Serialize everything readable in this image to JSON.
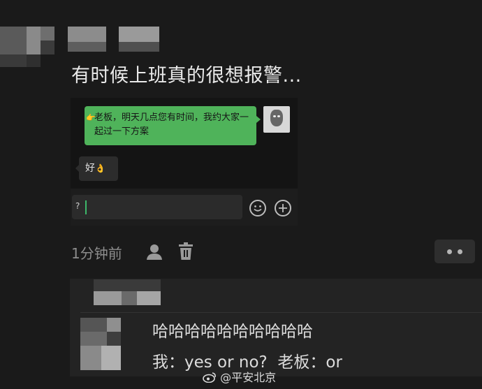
{
  "post": {
    "text": "有时候上班真的很想报警..."
  },
  "screenshot": {
    "boss_message": "老板，明天几点您有时间，我约大家一起过一下方案",
    "boss_message_icon": "hand-pointing-emoji",
    "reply": "好",
    "reply_emoji": "👌",
    "input_value": "?",
    "emoji_icon": "smiley-icon",
    "plus_icon": "plus-circle-icon"
  },
  "meta": {
    "time": "1分钟前",
    "icons": [
      "person-icon",
      "trash-icon",
      "more-dots-icon"
    ]
  },
  "comment": {
    "line1": "哈哈哈哈哈哈哈哈哈哈",
    "line2": "我：yes or no?  老板：or"
  },
  "watermark": {
    "text": "@平安北京",
    "icon": "weibo-icon"
  },
  "colors": {
    "background": "#1a1a1a",
    "bubble_green": "#4fb35a",
    "bubble_grey": "#2c2c2c",
    "caret": "#3db86a"
  }
}
